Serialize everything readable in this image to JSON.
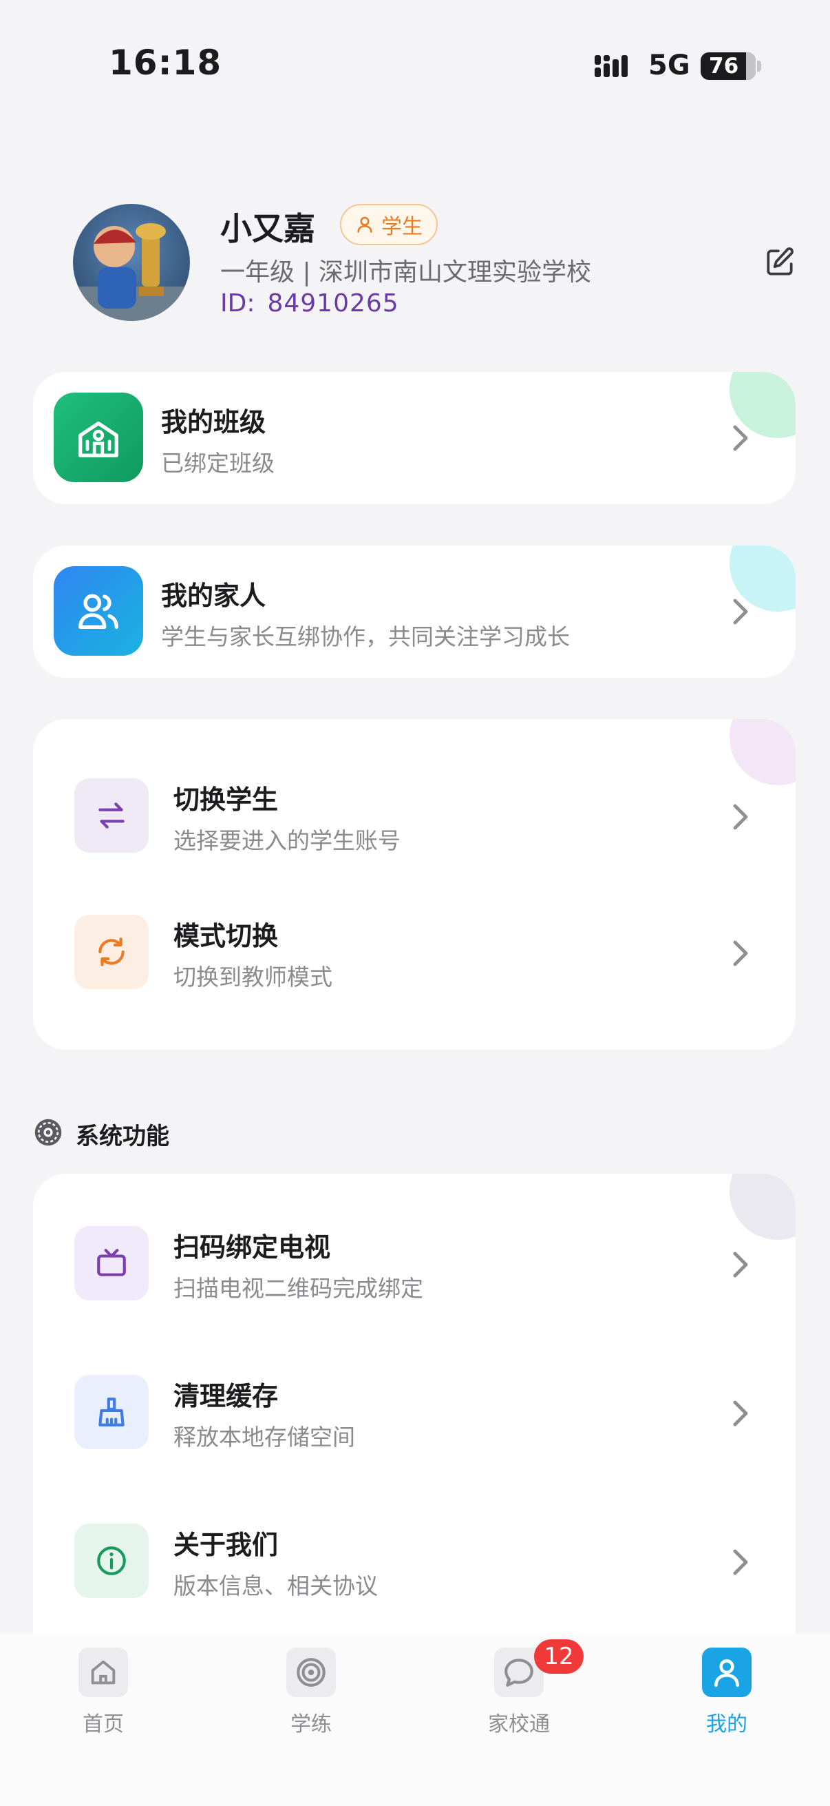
{
  "status_bar": {
    "time": "16:18",
    "network": "5G",
    "battery": "76"
  },
  "profile": {
    "name": "小又嘉",
    "role": "学生",
    "school": "一年级 | 深圳市南山文理实验学校",
    "id_label": "ID:",
    "id_value": "84910265"
  },
  "cards": {
    "my_class": {
      "title": "我的班级",
      "subtitle": "已绑定班级"
    },
    "my_family": {
      "title": "我的家人",
      "subtitle": "学生与家长互绑协作，共同关注学习成长"
    }
  },
  "account": [
    {
      "title": "切换学生",
      "subtitle": "选择要进入的学生账号",
      "icon": "switch-arrows-icon"
    },
    {
      "title": "模式切换",
      "subtitle": "切换到教师模式",
      "icon": "refresh-icon"
    }
  ],
  "system": {
    "section_title": "系统功能",
    "items": [
      {
        "title": "扫码绑定电视",
        "subtitle": "扫描电视二维码完成绑定",
        "icon": "tv-icon"
      },
      {
        "title": "清理缓存",
        "subtitle": "释放本地存储空间",
        "icon": "broom-icon"
      },
      {
        "title": "关于我们",
        "subtitle": "版本信息、相关协议",
        "icon": "info-icon"
      }
    ]
  },
  "tabbar": {
    "items": [
      {
        "label": "首页",
        "icon": "home-icon"
      },
      {
        "label": "学练",
        "icon": "target-icon"
      },
      {
        "label": "家校通",
        "icon": "chat-icon"
      },
      {
        "label": "我的",
        "icon": "user-icon"
      }
    ],
    "badge": "12",
    "active": "我的"
  },
  "colors": {
    "accent": "#1aa4e6",
    "class_icon": "#14a86a",
    "family_icon": "#2a8ff0",
    "id_text": "#6a3ba8",
    "badge": "#f03a3a"
  }
}
